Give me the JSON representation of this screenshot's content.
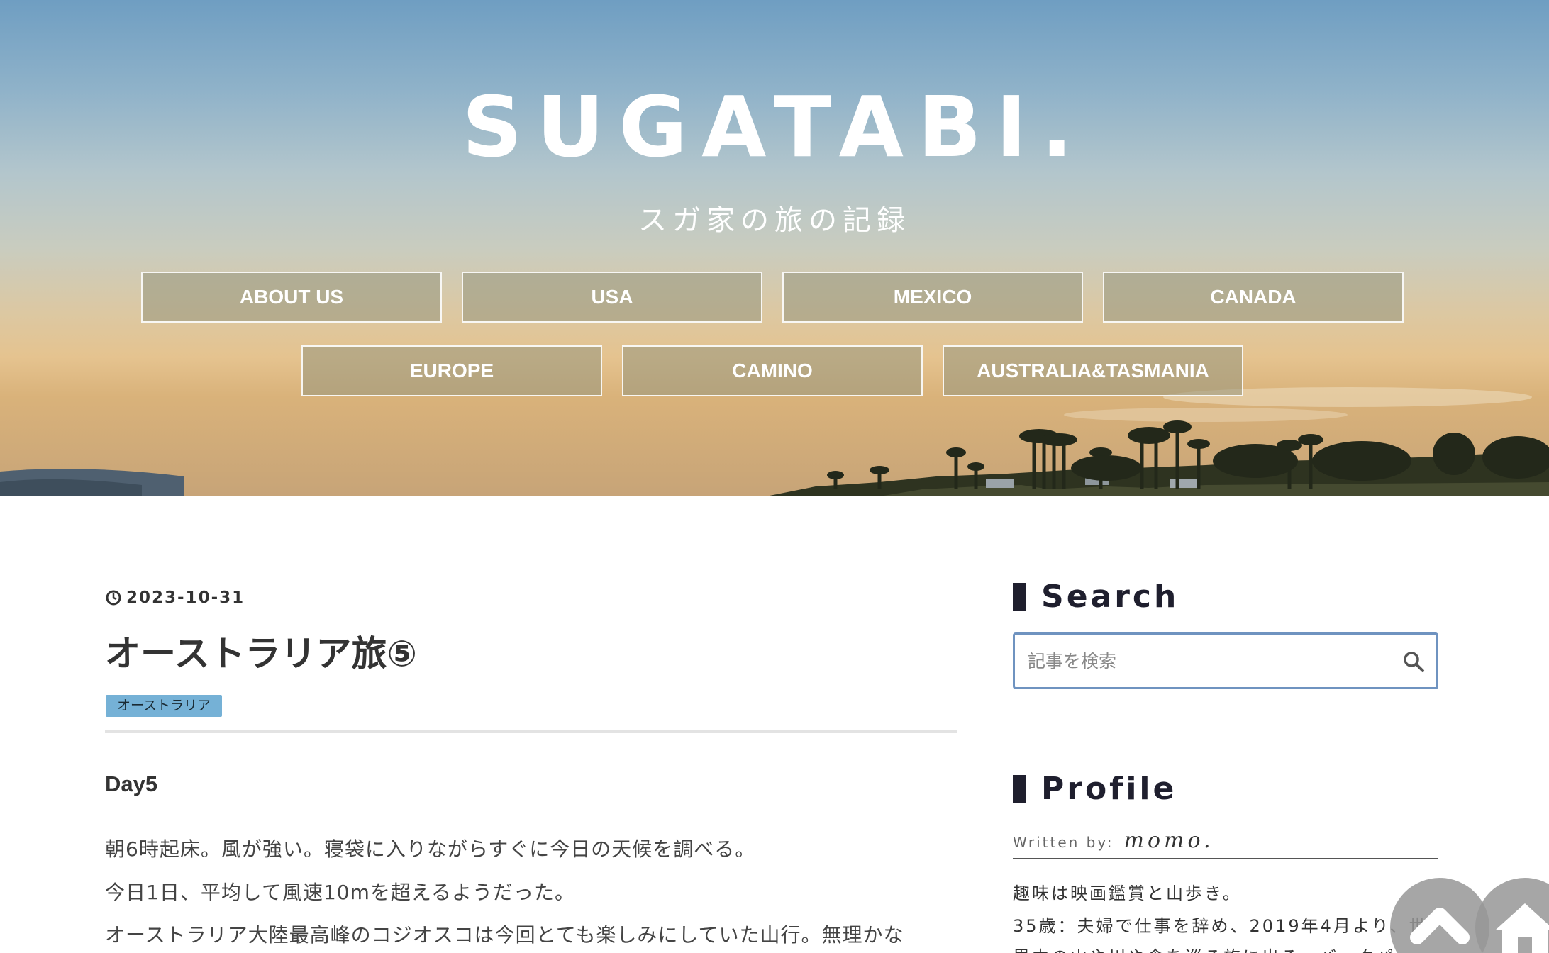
{
  "header": {
    "site_title": "SUGATABI.",
    "site_subtitle": "スガ家の旅の記録"
  },
  "nav": {
    "items": [
      {
        "label": "ABOUT US"
      },
      {
        "label": "USA"
      },
      {
        "label": "MEXICO"
      },
      {
        "label": "CANADA"
      },
      {
        "label": "EUROPE"
      },
      {
        "label": "CAMINO"
      },
      {
        "label": "AUSTRALIA&TASMANIA"
      }
    ]
  },
  "article": {
    "date": "2023-10-31",
    "title": "オーストラリア旅⑤",
    "category": "オーストラリア",
    "day_heading": "Day5",
    "paragraphs": [
      "朝6時起床。風が強い。寝袋に入りながらすぐに今日の天候を調べる。",
      "今日1日、平均して風速10mを超えるようだった。",
      "オーストラリア大陸最高峰のコジオスコは今回とても楽しみにしていた山行。無理かな"
    ]
  },
  "sidebar": {
    "search": {
      "title": "Search",
      "placeholder": "記事を検索"
    },
    "profile": {
      "title": "Profile",
      "written_by_label": "Written by:",
      "author": "momo.",
      "lines": [
        "趣味は映画鑑賞と山歩き。",
        "35歳：夫婦で仕事を辞め、2019年4月より、世",
        "界中の山や川や食を巡る旅に出る。バックパッ"
      ]
    }
  },
  "icons": {
    "date": "clock-icon",
    "search": "search-icon",
    "scroll_top": "chevron-up-icon",
    "home": "home-icon"
  },
  "colors": {
    "badge_bg": "#75b1d6",
    "search_border": "#6f93c0",
    "widget_bar": "#1f1f2e"
  }
}
